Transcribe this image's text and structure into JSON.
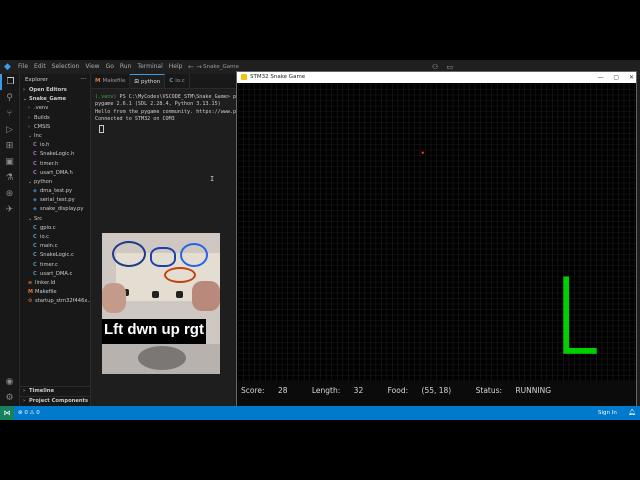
{
  "vscode": {
    "menu": [
      "File",
      "Edit",
      "Selection",
      "View",
      "Go",
      "Run",
      "Terminal",
      "Help"
    ],
    "search_text": "Snake_Game",
    "explorer_title": "Explorer",
    "open_editors": "Open Editors",
    "project": "Snake_Game",
    "tree": [
      {
        "label": ".venv",
        "kind": "folder",
        "depth": 1,
        "open": false
      },
      {
        "label": "Builds",
        "kind": "folder",
        "depth": 1,
        "open": false
      },
      {
        "label": "CMSIS",
        "kind": "folder",
        "depth": 1,
        "open": false
      },
      {
        "label": "Inc",
        "kind": "folder",
        "depth": 1,
        "open": true
      },
      {
        "label": "io.h",
        "kind": "h",
        "depth": 2
      },
      {
        "label": "SnakeLogic.h",
        "kind": "h",
        "depth": 2
      },
      {
        "label": "timer.h",
        "kind": "h",
        "depth": 2
      },
      {
        "label": "usart_DMA.h",
        "kind": "h",
        "depth": 2
      },
      {
        "label": "python",
        "kind": "folder",
        "depth": 1,
        "open": true
      },
      {
        "label": "dma_test.py",
        "kind": "py",
        "depth": 2
      },
      {
        "label": "serial_test.py",
        "kind": "py",
        "depth": 2
      },
      {
        "label": "snake_display.py",
        "kind": "py",
        "depth": 2
      },
      {
        "label": "Src",
        "kind": "folder",
        "depth": 1,
        "open": true
      },
      {
        "label": "gpio.c",
        "kind": "c",
        "depth": 2
      },
      {
        "label": "io.c",
        "kind": "c",
        "depth": 2
      },
      {
        "label": "main.c",
        "kind": "c",
        "depth": 2
      },
      {
        "label": "SnakeLogic.c",
        "kind": "c",
        "depth": 2
      },
      {
        "label": "timer.c",
        "kind": "c",
        "depth": 2
      },
      {
        "label": "usart_DMA.c",
        "kind": "c",
        "depth": 2
      },
      {
        "label": "linker.ld",
        "kind": "ld",
        "depth": 1
      },
      {
        "label": "Makefile",
        "kind": "mk",
        "depth": 1
      },
      {
        "label": "startup_stm32f446x...",
        "kind": "s",
        "depth": 1
      }
    ],
    "timeline": "Timeline",
    "project_components": "Project Components",
    "tabs": [
      {
        "label": "Makefile",
        "icon": "M",
        "color": "#e37933",
        "active": false
      },
      {
        "label": "python",
        "icon": "⊡",
        "color": "#cccccc",
        "active": true
      },
      {
        "label": "io.c",
        "icon": "C",
        "color": "#519aba",
        "active": false
      }
    ],
    "terminal": {
      "venv": "(.venv)",
      "prompt": "PS C:\\MyCodes\\VSCODE_STM\\Snake_Game> p",
      "lines": [
        "pygame 2.6.1 (SDL 2.28.4, Python 3.13.15)",
        "Hello from the pygame community. https://www.p",
        "Connected to STM32 on COM3"
      ]
    },
    "overlay_caption": "Lft dwn up rgt",
    "statusbar": {
      "problems": "⊗ 0  ⚠ 0",
      "signin": "Sign In"
    }
  },
  "game_window": {
    "title": "STM32 Snake Game",
    "colors": {
      "snake": "#00d000",
      "food": "#ff3030",
      "grid": "#1c1c1c",
      "background": "#000000"
    },
    "grid": {
      "cols": 72,
      "rows": 54
    },
    "snake_cells": [
      [
        59,
        35
      ],
      [
        59,
        36
      ],
      [
        59,
        37
      ],
      [
        59,
        38
      ],
      [
        59,
        39
      ],
      [
        59,
        40
      ],
      [
        59,
        41
      ],
      [
        59,
        42
      ],
      [
        59,
        43
      ],
      [
        59,
        44
      ],
      [
        59,
        45
      ],
      [
        59,
        46
      ],
      [
        59,
        47
      ],
      [
        59,
        48
      ],
      [
        60,
        48
      ],
      [
        61,
        48
      ],
      [
        62,
        48
      ],
      [
        63,
        48
      ],
      [
        64,
        48
      ]
    ],
    "status": {
      "score_label": "Score:",
      "score": "28",
      "length_label": "Length:",
      "length": "32",
      "food_label": "Food:",
      "food": "(55, 18)",
      "status_label": "Status:",
      "status": "RUNNING"
    },
    "food_cell": [
      33,
      12
    ]
  }
}
